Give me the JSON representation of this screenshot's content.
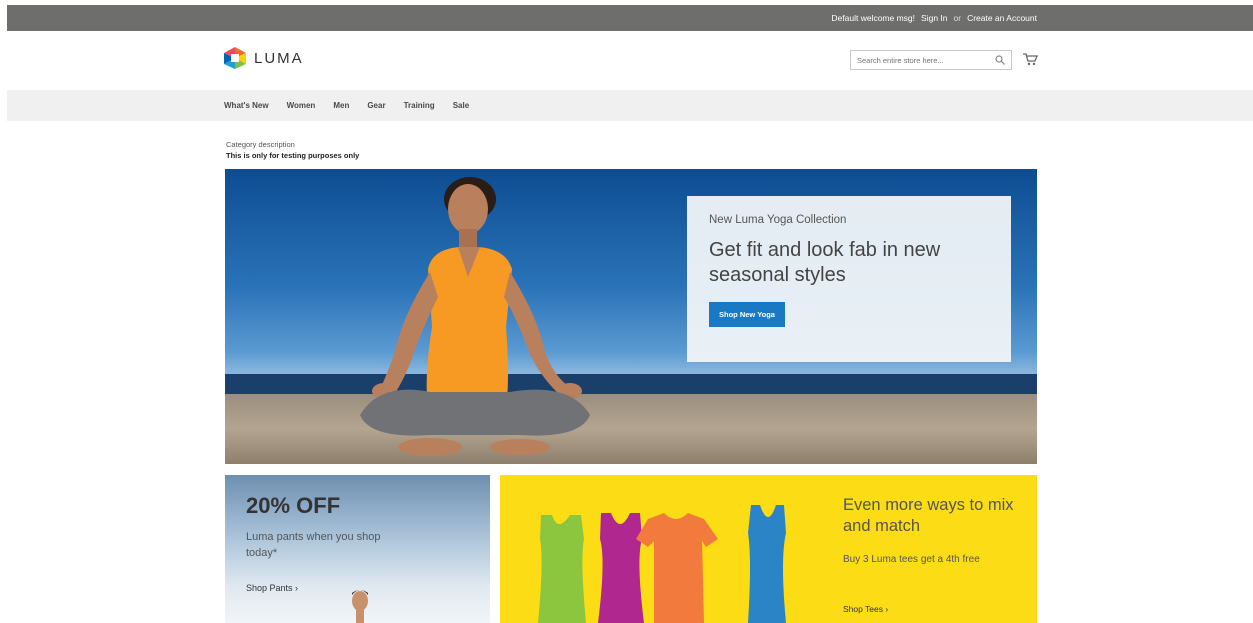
{
  "header_top": {
    "welcome": "Default welcome msg!",
    "sign_in": "Sign In",
    "or": "or",
    "create_account": "Create an Account"
  },
  "logo": {
    "text": "LUMA"
  },
  "search": {
    "placeholder": "Search entire store here..."
  },
  "nav": {
    "items": [
      "What's New",
      "Women",
      "Men",
      "Gear",
      "Training",
      "Sale"
    ]
  },
  "category": {
    "description_label": "Category description",
    "description_text": "This is only for testing purposes only"
  },
  "hero": {
    "kicker": "New Luma Yoga Collection",
    "title": "Get fit and look fab in new seasonal styles",
    "button": "Shop New Yoga"
  },
  "promo_left": {
    "title": "20% OFF",
    "text": "Luma pants when you shop today*",
    "link": "Shop Pants ›"
  },
  "promo_right": {
    "title": "Even more ways to mix and match",
    "text": "Buy 3 Luma tees get a 4th free",
    "link": "Shop Tees ›"
  },
  "colors": {
    "topbar": "#6e6e6c",
    "nav_bg": "#f0f0f0",
    "accent": "#1979c3",
    "promo_yellow": "#fcdc14"
  }
}
